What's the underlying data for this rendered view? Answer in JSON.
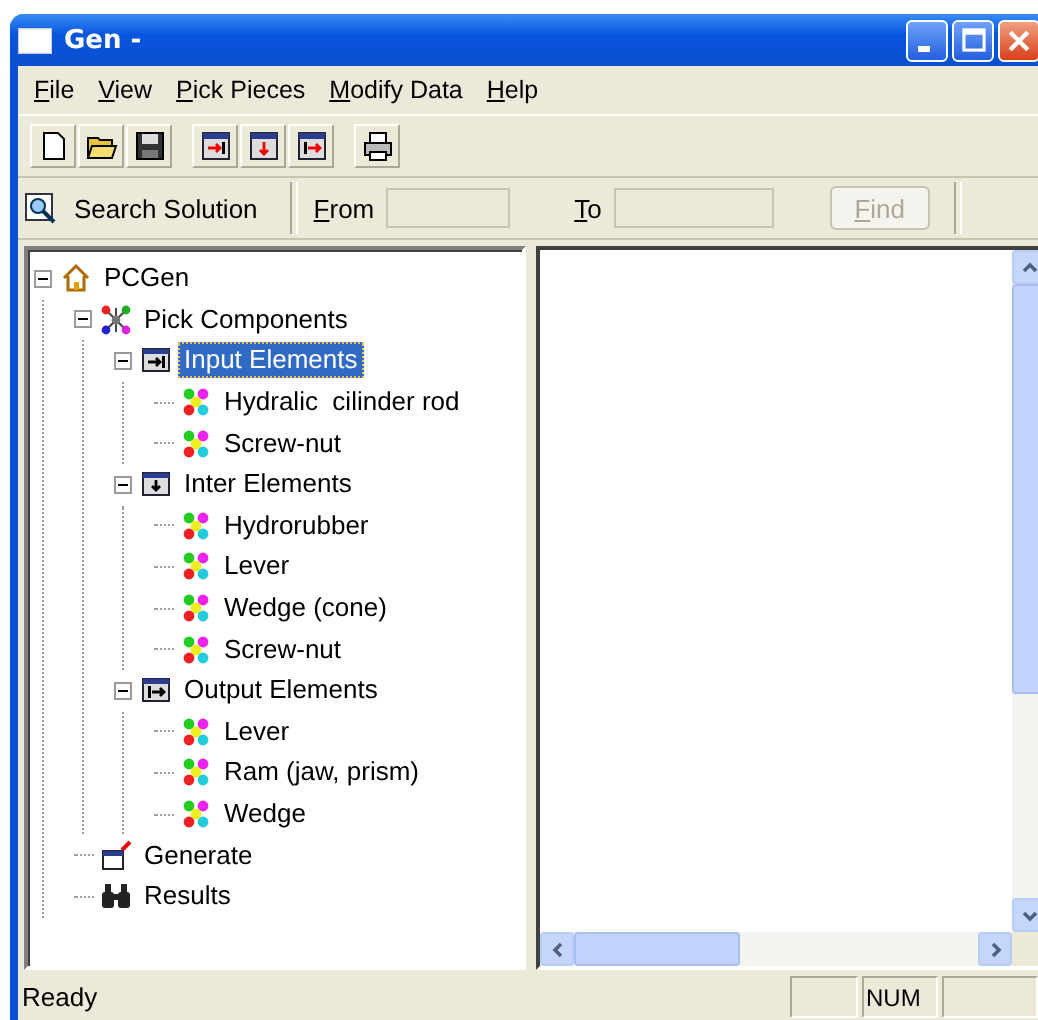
{
  "window": {
    "title": "Gen -"
  },
  "menu": [
    "File",
    "View",
    "Pick Pieces",
    "Modify Data",
    "Help"
  ],
  "toolbar": [
    {
      "kind": "new"
    },
    {
      "kind": "open"
    },
    {
      "kind": "save"
    },
    {
      "kind": "sep"
    },
    {
      "kind": "input"
    },
    {
      "kind": "inter"
    },
    {
      "kind": "output"
    },
    {
      "kind": "sep"
    },
    {
      "kind": "print"
    }
  ],
  "search_bar": {
    "label": "Search Solution",
    "from_label": "From",
    "to_label": "To",
    "find_button": "Find",
    "find_disabled": true
  },
  "tree": [
    {
      "label": "PCGen",
      "kind": "home",
      "expanded": true,
      "selected": false,
      "children": [
        {
          "label": "Pick Components",
          "kind": "components",
          "expanded": true,
          "selected": false,
          "children": [
            {
              "label": "Input Elements",
              "kind": "input",
              "expanded": true,
              "selected": true,
              "children": [
                {
                  "label": "Hydralic  cilinder rod",
                  "kind": "part",
                  "selected": false
                },
                {
                  "label": "Screw-nut",
                  "kind": "part",
                  "selected": false
                }
              ]
            },
            {
              "label": "Inter Elements",
              "kind": "inter",
              "expanded": true,
              "selected": false,
              "children": [
                {
                  "label": "Hydrorubber",
                  "kind": "part",
                  "selected": false
                },
                {
                  "label": "Lever",
                  "kind": "part",
                  "selected": false
                },
                {
                  "label": "Wedge (cone)",
                  "kind": "part",
                  "selected": false
                },
                {
                  "label": "Screw-nut",
                  "kind": "part",
                  "selected": false
                }
              ]
            },
            {
              "label": "Output Elements",
              "kind": "output",
              "expanded": true,
              "selected": false,
              "children": [
                {
                  "label": "Lever",
                  "kind": "part",
                  "selected": false
                },
                {
                  "label": "Ram (jaw, prism)",
                  "kind": "part",
                  "selected": false
                },
                {
                  "label": "Wedge",
                  "kind": "part",
                  "selected": false
                }
              ]
            }
          ]
        },
        {
          "label": "Generate",
          "kind": "generate",
          "selected": false
        },
        {
          "label": "Results",
          "kind": "results",
          "selected": false
        }
      ]
    }
  ],
  "status_bar": {
    "message": "Ready",
    "indicator": "NUM"
  }
}
